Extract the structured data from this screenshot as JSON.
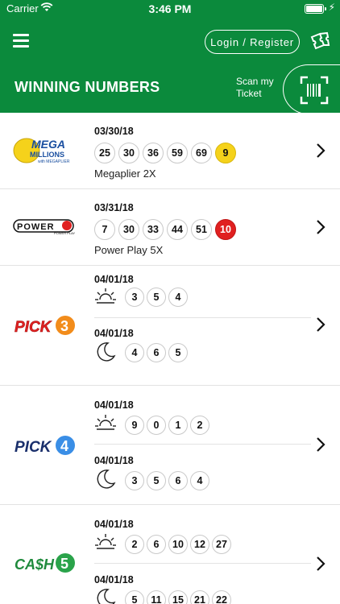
{
  "status_bar": {
    "carrier": "Carrier",
    "time": "3:46 PM"
  },
  "header": {
    "login_label": "Login / Register",
    "title": "WINNING NUMBERS",
    "scan_label": "Scan my Ticket"
  },
  "games": [
    {
      "name": "Mega Millions",
      "logo_text": "MEGA MILLIONS",
      "date": "03/30/18",
      "numbers": [
        "25",
        "30",
        "36",
        "59",
        "69"
      ],
      "bonus": "9",
      "bonus_color": "#f5d21b",
      "extra": "Megaplier 2X"
    },
    {
      "name": "Powerball",
      "logo_text": "POWERBALL",
      "date": "03/31/18",
      "numbers": [
        "7",
        "30",
        "33",
        "44",
        "51"
      ],
      "bonus": "10",
      "bonus_color": "#e02020",
      "extra": "Power Play 5X"
    },
    {
      "name": "Pick 3",
      "logo_text": "PICK",
      "logo_digit": "3",
      "day": {
        "date": "04/01/18",
        "numbers": [
          "3",
          "5",
          "4"
        ]
      },
      "night": {
        "date": "04/01/18",
        "numbers": [
          "4",
          "6",
          "5"
        ]
      }
    },
    {
      "name": "Pick 4",
      "logo_text": "PICK",
      "logo_digit": "4",
      "day": {
        "date": "04/01/18",
        "numbers": [
          "9",
          "0",
          "1",
          "2"
        ]
      },
      "night": {
        "date": "04/01/18",
        "numbers": [
          "3",
          "5",
          "6",
          "4"
        ]
      }
    },
    {
      "name": "Cash 5",
      "logo_text": "CA$H",
      "logo_digit": "5",
      "day": {
        "date": "04/01/18",
        "numbers": [
          "2",
          "6",
          "10",
          "12",
          "27"
        ]
      },
      "night": {
        "date": "04/01/18",
        "numbers": [
          "5",
          "11",
          "15",
          "21",
          "22"
        ]
      }
    }
  ],
  "icons": {
    "menu": "hamburger-icon",
    "tickets": "tickets-icon",
    "scan": "barcode-scan-icon",
    "chevron": "chevron-right-icon",
    "day": "sun-icon",
    "night": "moon-icon"
  },
  "colors": {
    "brand_green": "#0b8a3c",
    "mega_gold": "#f5d21b",
    "power_red": "#e02020",
    "pick_orange": "#f28c1b",
    "pick4_blue": "#1a4fa0",
    "cash_green": "#2aa34a"
  }
}
